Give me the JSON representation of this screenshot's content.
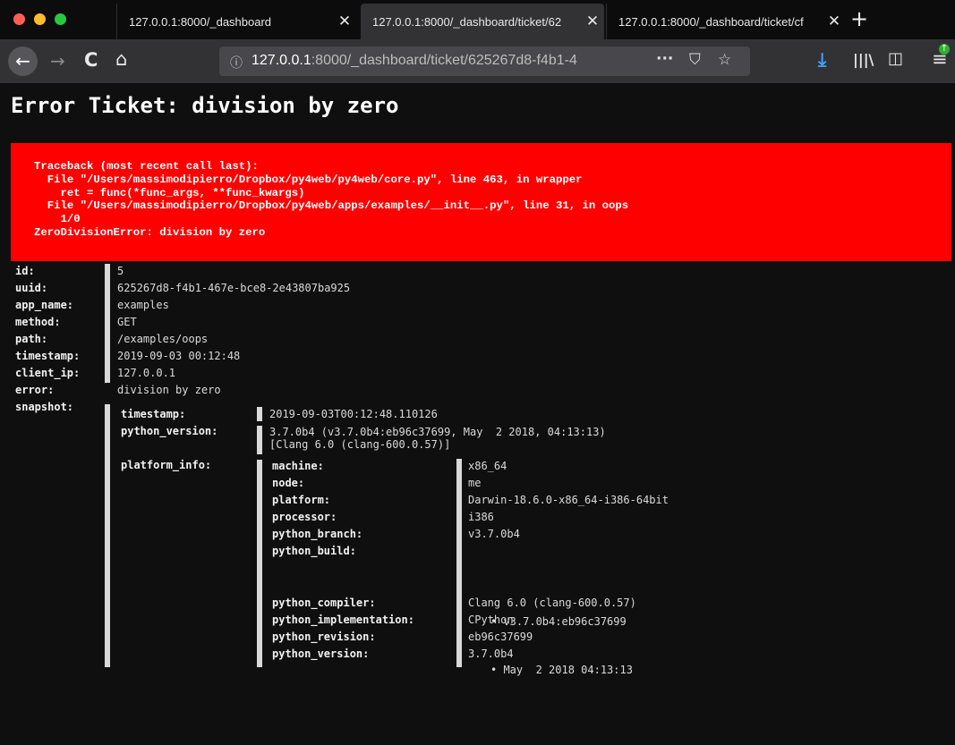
{
  "browser": {
    "tabs": [
      {
        "title": "127.0.0.1:8000/_dashboard",
        "active": false
      },
      {
        "title": "127.0.0.1:8000/_dashboard/ticket/62",
        "active": true
      },
      {
        "title": "127.0.0.1:8000/_dashboard/ticket/cf",
        "active": false
      }
    ],
    "url_host": "127.0.0.1",
    "url_rest": ":8000/_dashboard/ticket/625267d8-f4b1-4",
    "icons": [
      "back-icon",
      "forward-icon",
      "reload-icon",
      "home-icon",
      "info-icon",
      "more-icon",
      "pocket-icon",
      "bookmark-star-icon",
      "download-icon",
      "library-icon",
      "sidebar-icon",
      "menu-icon"
    ]
  },
  "page": {
    "title": "Error Ticket: division by zero",
    "traceback": [
      "Traceback (most recent call last):",
      "  File \"/Users/massimodipierro/Dropbox/py4web/py4web/core.py\", line 463, in wrapper",
      "    ret = func(*func_args, **func_kwargs)",
      "  File \"/Users/massimodipierro/Dropbox/py4web/apps/examples/__init__.py\", line 31, in oops",
      "    1/0",
      "ZeroDivisionError: division by zero"
    ],
    "colors": {
      "traceback_bg": "#ff0000",
      "page_bg": "#0f0f0f"
    }
  },
  "ticket": {
    "rows": [
      {
        "key": "id:",
        "value": "5"
      },
      {
        "key": "uuid:",
        "value": "625267d8-f4b1-467e-bce8-2e43807ba925"
      },
      {
        "key": "app_name:",
        "value": "examples"
      },
      {
        "key": "method:",
        "value": "GET"
      },
      {
        "key": "path:",
        "value": "/examples/oops"
      },
      {
        "key": "timestamp:",
        "value": "2019-09-03 00:12:48"
      },
      {
        "key": "client_ip:",
        "value": "127.0.0.1"
      },
      {
        "key": "error:",
        "value": "division by zero"
      }
    ],
    "snapshot_key": "snapshot:"
  },
  "snapshot": {
    "timestamp_key": "timestamp:",
    "timestamp": "2019-09-03T00:12:48.110126",
    "python_version_key": "python_version:",
    "python_version_line1": "3.7.0b4 (v3.7.0b4:eb96c37699, May  2 2018, 04:13:13)",
    "python_version_line2": "[Clang 6.0 (clang-600.0.57)]",
    "platform_info_key": "platform_info:"
  },
  "platform": {
    "rows_top": [
      {
        "key": "machine:",
        "value": "x86_64"
      },
      {
        "key": "node:",
        "value": "me"
      },
      {
        "key": "platform:",
        "value": "Darwin-18.6.0-x86_64-i386-64bit"
      },
      {
        "key": "processor:",
        "value": "i386"
      },
      {
        "key": "python_branch:",
        "value": "v3.7.0b4"
      }
    ],
    "python_build_key": "python_build:",
    "python_build": [
      "v3.7.0b4:eb96c37699",
      "May  2 2018 04:13:13"
    ],
    "rows_bottom": [
      {
        "key": "python_compiler:",
        "value": "Clang 6.0 (clang-600.0.57)"
      },
      {
        "key": "python_implementation:",
        "value": "CPython"
      },
      {
        "key": "python_revision:",
        "value": "eb96c37699"
      },
      {
        "key": "python_version:",
        "value": "3.7.0b4"
      }
    ]
  }
}
